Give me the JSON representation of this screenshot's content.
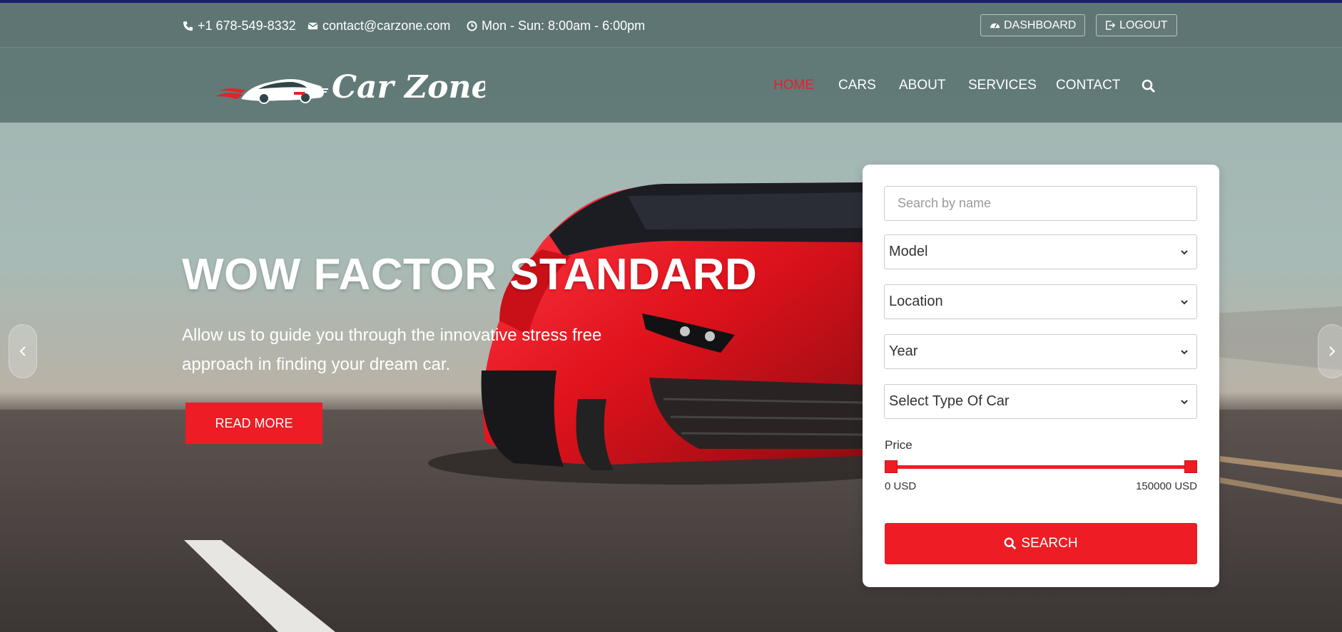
{
  "colors": {
    "accent": "#ee1c25",
    "top_border": "#1b1f6b",
    "white": "#ffffff"
  },
  "topbar": {
    "phone": {
      "icon": "phone-icon",
      "text": "+1 678-549-8332"
    },
    "email": {
      "icon": "envelope-icon",
      "text": "contact@carzone.com"
    },
    "hours": {
      "icon": "clock-icon",
      "text": "Mon - Sun: 8:00am - 6:00pm"
    },
    "dashboard": {
      "icon": "dashboard-icon",
      "label": "DASHBOARD"
    },
    "logout": {
      "icon": "logout-icon",
      "label": "LOGOUT"
    }
  },
  "nav": {
    "logo_text": "Car Zone",
    "items": [
      {
        "label": "HOME",
        "active": true
      },
      {
        "label": "CARS"
      },
      {
        "label": "ABOUT"
      },
      {
        "label": "SERVICES"
      },
      {
        "label": "CONTACT"
      }
    ],
    "search_icon": "search-icon"
  },
  "hero": {
    "title": "WOW FACTOR STANDARD",
    "subtitle": "Allow us to guide you through the innovative stress free approach in finding your dream car.",
    "button": "READ MORE",
    "prev_icon": "chevron-left-icon",
    "next_icon": "chevron-right-icon"
  },
  "search_panel": {
    "name_placeholder": "Search by name",
    "model": "Model",
    "location": "Location",
    "year": "Year",
    "type": "Select Type Of Car",
    "price_label": "Price",
    "price_min": "0 USD",
    "price_max": "150000 USD",
    "price_range_fraction": [
      0,
      1
    ],
    "search_button": "SEARCH"
  }
}
